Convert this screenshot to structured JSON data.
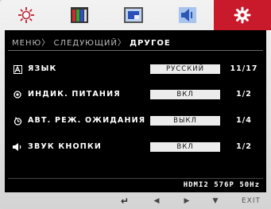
{
  "colors": {
    "active_tab": "#c81a2a",
    "panel_bg": "#000000",
    "value_box": "#ececec"
  },
  "tabs": [
    {
      "icon": "brightness-sun-icon"
    },
    {
      "icon": "color-bars-icon"
    },
    {
      "icon": "picture-frame-icon"
    },
    {
      "icon": "speaker-icon"
    },
    {
      "icon": "gear-icon",
      "active": true
    }
  ],
  "breadcrumb": {
    "item1": "МЕНЮ〉",
    "item2": "СЛЕДУЮЩИЙ〉",
    "current": "ДРУГОЕ"
  },
  "rows": [
    {
      "icon": "language-icon",
      "label": "ЯЗЫК",
      "value": "РУССКИЙ",
      "count": "11/17"
    },
    {
      "icon": "power-indicator-icon",
      "label": "ИНДИК. ПИТАНИЯ",
      "value": "ВКЛ",
      "count": "1/2"
    },
    {
      "icon": "standby-timer-icon",
      "label": "АВТ. РЕЖ. ОЖИДАНИЯ",
      "value": "ВЫКЛ",
      "count": "1/4"
    },
    {
      "icon": "button-sound-icon",
      "label": "ЗВУК КНОПКИ",
      "value": "ВКЛ",
      "count": "1/2"
    }
  ],
  "status": "HDMI2 576P 50Hz",
  "bottom": {
    "enter": "↵",
    "left": "◀",
    "right": "▶",
    "down": "▼",
    "exit": "EXIT"
  }
}
